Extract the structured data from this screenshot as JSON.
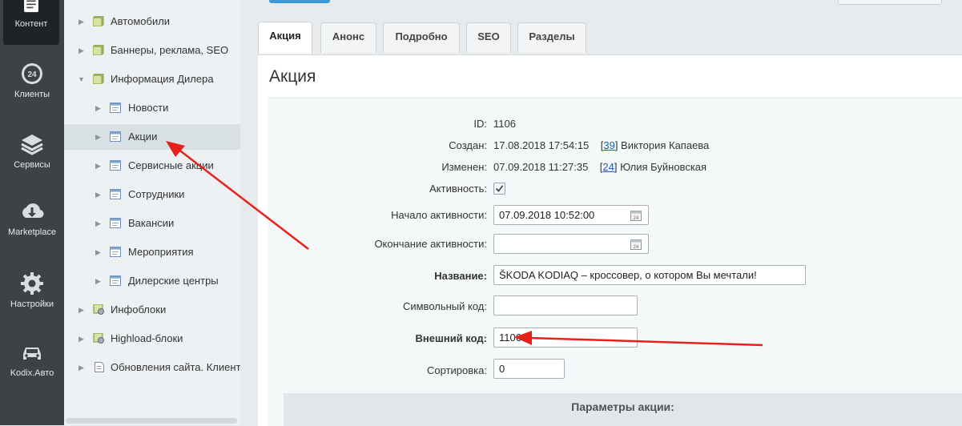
{
  "rail": {
    "items": [
      {
        "label": "Контент",
        "icon": "content-icon"
      },
      {
        "label": "Клиенты",
        "icon": "clients-24-icon",
        "badge": "24"
      },
      {
        "label": "Сервисы",
        "icon": "layers-icon"
      },
      {
        "label": "Marketplace",
        "icon": "cloud-download-icon"
      },
      {
        "label": "Настройки",
        "icon": "gear-icon"
      },
      {
        "label": "Kodix.Авто",
        "icon": "car-icon"
      }
    ]
  },
  "tree": {
    "items": [
      {
        "label": "Автомобили"
      },
      {
        "label": "Баннеры, реклама, SEO"
      },
      {
        "label": "Информация Дилера"
      },
      {
        "label": "Новости"
      },
      {
        "label": "Акции"
      },
      {
        "label": "Сервисные акции"
      },
      {
        "label": "Сотрудники"
      },
      {
        "label": "Вакансии"
      },
      {
        "label": "Мероприятия"
      },
      {
        "label": "Дилерские центры"
      },
      {
        "label": "Инфоблоки"
      },
      {
        "label": "Highload-блоки"
      },
      {
        "label": "Обновления сайта. Клиент"
      }
    ]
  },
  "tabs": [
    "Акция",
    "Анонс",
    "Подробно",
    "SEO",
    "Разделы"
  ],
  "section_title": "Акция",
  "form": {
    "id_label": "ID:",
    "id_value": "1106",
    "created_label": "Создан:",
    "created_date": "17.08.2018 17:54:15",
    "created_user_id": "39",
    "created_user_name": "Виктория Капаева",
    "modified_label": "Изменен:",
    "modified_date": "07.09.2018 11:27:35",
    "modified_user_id": "24",
    "modified_user_name": "Юлия Буйновская",
    "active_label": "Активность:",
    "active_checked": true,
    "start_label": "Начало активности:",
    "start_value": "07.09.2018 10:52:00",
    "end_label": "Окончание активности:",
    "end_value": "",
    "name_label": "Название:",
    "name_value": "ŠKODA KODIAQ – кроссовер, о котором Вы мечтали!",
    "code_label": "Символьный код:",
    "code_value": "",
    "xml_label": "Внешний код:",
    "xml_value": "1106",
    "sort_label": "Сортировка:",
    "sort_value": "0"
  },
  "params_header": "Параметры акции:",
  "colors": {
    "rail_bg": "#3c4246",
    "accent_blue": "#3b9bd9",
    "annotation_arrow": "#e8201a",
    "link": "#1a5ea8"
  }
}
